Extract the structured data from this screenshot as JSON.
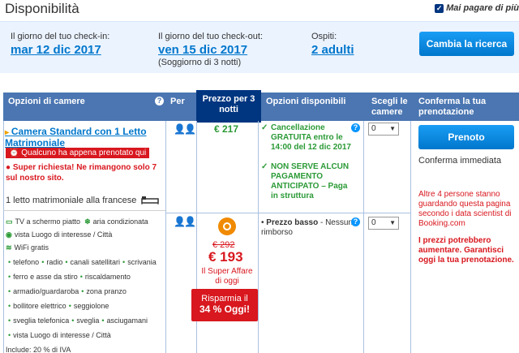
{
  "header": {
    "title": "Disponibilità",
    "guarantee": "Mai pagare di più"
  },
  "dates": {
    "checkin_label": "Il giorno del tuo check-in:",
    "checkin_value": "mar 12 dic 2017",
    "checkout_label": "Il giorno del tuo check-out:",
    "checkout_value": "ven 15 dic 2017",
    "stay_note": "(Soggiorno di 3 notti)",
    "guests_label": "Ospiti:",
    "guests_value": "2 adulti",
    "change_button": "Cambia la ricerca"
  },
  "table": {
    "headers": {
      "rooms": "Opzioni di camere",
      "per": "Per",
      "price": "Prezzo per 3 notti",
      "options": "Opzioni disponibili",
      "choose": "Scegli le camere",
      "confirm": "Conferma la tua prenotazione"
    },
    "room": {
      "name": "Camera Standard con 1 Letto Matrimoniale",
      "booked_badge": "Qualcuno ha appena prenotato qui",
      "high_demand": "Super richiesta! Ne rimangono solo 7 sul nostro sito.",
      "bed": "1 letto matrimoniale alla francese",
      "facilities_featured": [
        "TV a schermo piatto",
        "aria condizionata",
        "vista Luogo di interesse / Città",
        "WiFi gratis"
      ],
      "facilities": [
        [
          "telefono",
          "radio",
          "canali satellitari",
          "scrivania"
        ],
        [
          "ferro e asse da stiro",
          "riscaldamento"
        ],
        [
          "armadio/guardaroba",
          "zona pranzo"
        ],
        [
          "bollitore elettrico",
          "seggiolone"
        ],
        [
          "sveglia telefonica",
          "sveglia",
          "asciugamani"
        ],
        [
          "vista Luogo di interesse / Città"
        ]
      ],
      "include": "Include: 20 % di IVA"
    },
    "offer1": {
      "price": "€ 217",
      "options": [
        "Cancellazione GRATUITA entro le 14:00 del 12 dic 2017",
        "NON SERVE ALCUN PAGAMENTO ANTICIPATO – Paga in struttura"
      ],
      "qty": "0"
    },
    "offer2": {
      "old_price": "€ 292",
      "new_price": "€ 193",
      "deal_text": "Il Super Affare di oggi",
      "save_line1": "Risparmia il",
      "save_line2": "34 % Oggi!",
      "option_bold": "Prezzo basso",
      "option_rest": " - Nessun rimborso",
      "qty": "0"
    },
    "booking": {
      "book_button": "Prenoto",
      "confirm_text": "Conferma immediata",
      "urgency": "Altre 4 persone stanno guardando questa pagina secondo i data scientist di Booking.com",
      "price_warning": "I prezzi potrebbero aumentare. Garantisci oggi la tua prenotazione."
    }
  }
}
